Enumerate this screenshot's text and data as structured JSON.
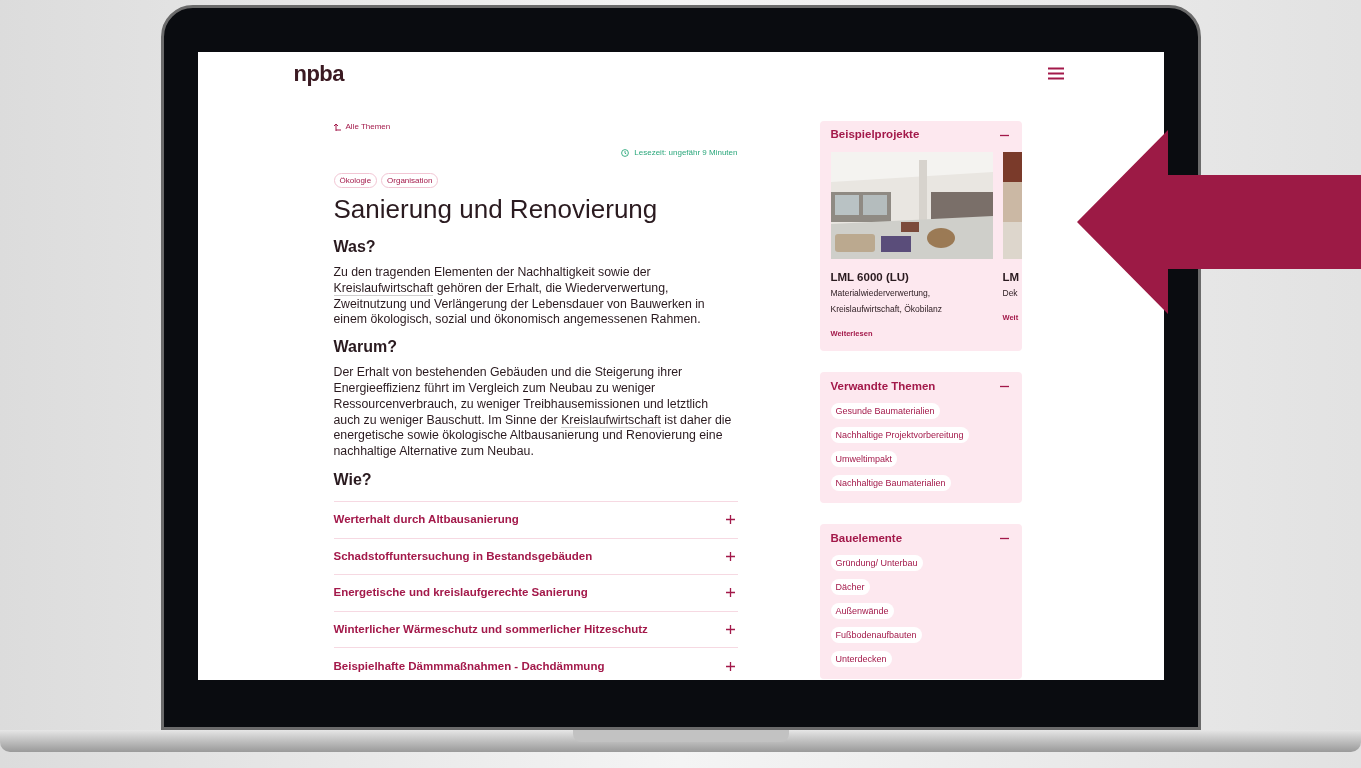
{
  "header": {
    "logo": "npba"
  },
  "back_link": "Alle Themen",
  "reading_time": "Lesezeit: ungefähr 9 Minuten",
  "tags": [
    "Ökologie",
    "Organisation"
  ],
  "title": "Sanierung und Renovierung",
  "sections": [
    {
      "heading": "Was?",
      "parts": [
        {
          "kind": "text",
          "text": "Zu den tragenden Elementen der Nachhaltigkeit sowie der "
        },
        {
          "kind": "link",
          "text": "Kreislaufwirtschaft"
        },
        {
          "kind": "text",
          "text": " gehören der Erhalt, die Wiederverwertung, Zweitnutzung und Verlängerung der Lebensdauer von Bauwerken in einem ökologisch, sozial und ökonomisch angemessenen Rahmen."
        }
      ]
    },
    {
      "heading": "Warum?",
      "parts": [
        {
          "kind": "text",
          "text": "Der Erhalt von bestehenden Gebäuden und die Steigerung ihrer Energieeffizienz führt im Vergleich zum Neubau zu weniger Ressourcenverbrauch, zu weniger Treibhausemissionen und letztlich auch zu weniger Bauschutt. Im Sinne der "
        },
        {
          "kind": "link",
          "text": "Kreislaufwirtschaft"
        },
        {
          "kind": "text",
          "text": " ist daher die energetische sowie ökologische Altbausanierung und Renovierung eine nachhaltige Alternative zum Neubau."
        }
      ]
    }
  ],
  "accordion": {
    "heading": "Wie?",
    "items": [
      {
        "label": "Werterhalt durch Altbausanierung",
        "expanded": false
      },
      {
        "label": "Schadstoffuntersuchung in Bestandsgebäuden",
        "expanded": false
      },
      {
        "label": "Energetische und kreislaufgerechte Sanierung",
        "expanded": false
      },
      {
        "label": "Winterlicher Wärmeschutz und sommerlicher Hitzeschutz",
        "expanded": false
      },
      {
        "label": "Beispielhafte  Dämmmaßnahmen - Dachdämmung",
        "expanded": false
      }
    ]
  },
  "sidebar": [
    {
      "kind": "projects",
      "title": "Beispielprojekte",
      "expanded": true,
      "projects": [
        {
          "name": "LML 6000 (LU)",
          "keywords": "Materialwiederverwertung, Kreislaufwirtschaft, Ökobilanz",
          "link": "Weiterlesen"
        },
        {
          "name": "LM",
          "keywords": "Dek",
          "link": "Weit"
        }
      ]
    },
    {
      "kind": "links",
      "title": "Verwandte Themen",
      "expanded": true,
      "links": [
        "Gesunde Baumaterialien",
        "Nachhaltige Projektvorbereitung",
        "Umweltimpakt",
        "Nachhaltige Baumaterialien"
      ]
    },
    {
      "kind": "links",
      "title": "Bauelemente",
      "expanded": true,
      "links": [
        "Gründung/ Unterbau",
        "Dächer",
        "Außenwände",
        "Fußbodenaufbauten",
        "Unterdecken"
      ]
    }
  ]
}
